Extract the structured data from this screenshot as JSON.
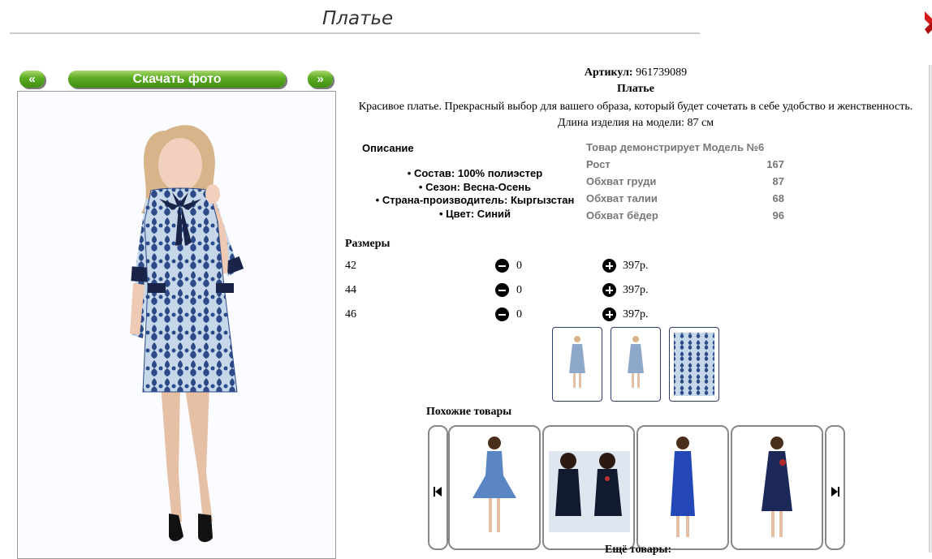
{
  "page": {
    "title": "Платье"
  },
  "nav": {
    "prev_label": "«",
    "download_label": "Скачать фото",
    "next_label": "»"
  },
  "product": {
    "sku_label": "Артикул:",
    "sku_value": "961739089",
    "name": "Платье",
    "description": "Красивое платье. Прекрасный выбор для вашего образа, который будет сочетать в себе удобство и женственность. Длина изделия на модели: 87 см"
  },
  "details": {
    "heading": "Описание",
    "items": [
      "Состав: 100% полиэстер",
      "Сезон: Весна-Осень",
      "Страна-производитель: Кыргызстан",
      "Цвет: Синий"
    ]
  },
  "model": {
    "heading": "Товар демонстрирует Модель №6",
    "rows": [
      {
        "label": "Рост",
        "value": "167"
      },
      {
        "label": "Обхват груди",
        "value": "87"
      },
      {
        "label": "Обхват талии",
        "value": "68"
      },
      {
        "label": "Обхват бёдер",
        "value": "96"
      }
    ]
  },
  "sizes": {
    "heading": "Размеры",
    "rows": [
      {
        "size": "42",
        "qty": "0",
        "price": "397р."
      },
      {
        "size": "44",
        "qty": "0",
        "price": "397р."
      },
      {
        "size": "46",
        "qty": "0",
        "price": "397р."
      }
    ]
  },
  "similar": {
    "heading": "Похожие товары"
  },
  "more": {
    "label": "Ещё товары:"
  },
  "colors": {
    "button_green": "#5aaa22",
    "dress_blue": "#2c4a86",
    "dress_light": "#c6d6ea",
    "navy": "#1a2448"
  }
}
